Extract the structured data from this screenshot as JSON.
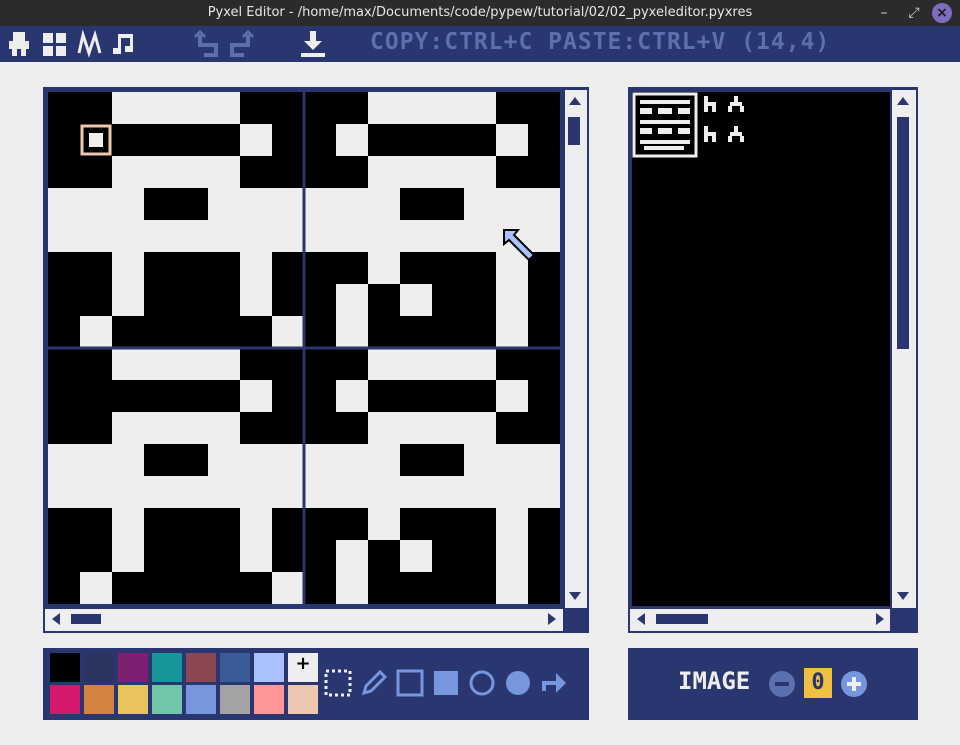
{
  "window": {
    "title": "Pyxel Editor - /home/max/Documents/code/pypew/tutorial/02/02_pyxeleditor.pyxres",
    "minimize_glyph": "–",
    "restore_glyph": "⤢",
    "close_glyph": "×"
  },
  "toolbar": {
    "status_text": "COPY:CTRL+C PASTE:CTRL+V (14,4)"
  },
  "editor": {
    "pattern": [
      "BBWWWWBBBBWWWWBB",
      "BSBBBBWBBWBBBBWB",
      "BBWWWWBBBBWWWWBB",
      "WWWBBWWWWWWBBWWW",
      "WWWWWWWWWWWWWWWW",
      "BBWBBBWBBBWBBBWB",
      "BBWBBBWBBWBWBBWB",
      "BWBBBBBWBWBBBBWB"
    ]
  },
  "image_bank": {
    "label": "IMAGE",
    "value": "0"
  },
  "palette": {
    "colors": [
      "#000000",
      "#2b335f",
      "#7e2072",
      "#19959c",
      "#8b4852",
      "#395c98",
      "#a9c1ff",
      "#eeeeee",
      "#d4186c",
      "#d38441",
      "#e9c35b",
      "#70c6a9",
      "#7696de",
      "#a3a3a3",
      "#ff9798",
      "#edc7b0"
    ]
  },
  "colors": {
    "navy": "#29366f",
    "paper": "#eeeeee",
    "accent": "#5c6fae",
    "select": "#f0c040"
  }
}
